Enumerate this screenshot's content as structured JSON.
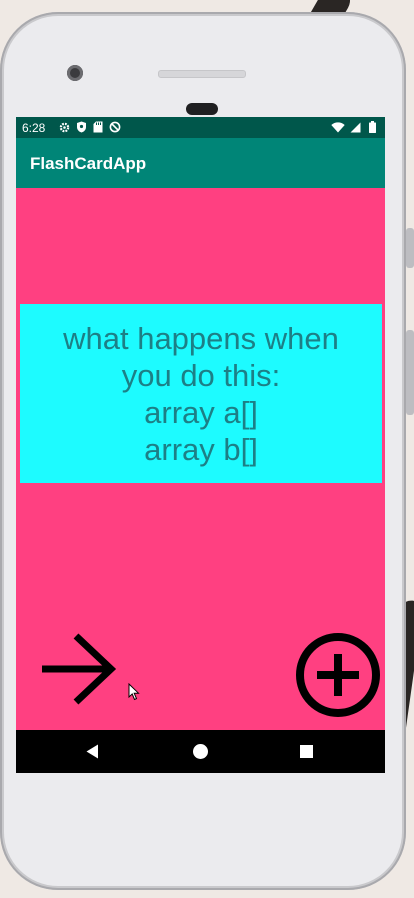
{
  "status_bar": {
    "time": "6:28",
    "left_icons": [
      "gear-icon",
      "shield-icon",
      "sd-card-icon",
      "no-sync-icon"
    ],
    "right_icons": [
      "wifi-icon",
      "signal-icon",
      "battery-icon"
    ]
  },
  "app_bar": {
    "title": "FlashCardApp"
  },
  "card": {
    "text": "what happens when\nyou do this:\narray a[]\narray b[]"
  },
  "colors": {
    "status_bar": "#00574b",
    "app_bar": "#008577",
    "screen_bg": "#ff4081",
    "card_bg": "#1dfbff",
    "card_text": "#1d7f86"
  },
  "controls": {
    "next": "arrow-right-icon",
    "add": "add-circle-icon"
  },
  "nav_bar": {
    "buttons": [
      "back-icon",
      "home-icon",
      "recents-icon"
    ]
  }
}
